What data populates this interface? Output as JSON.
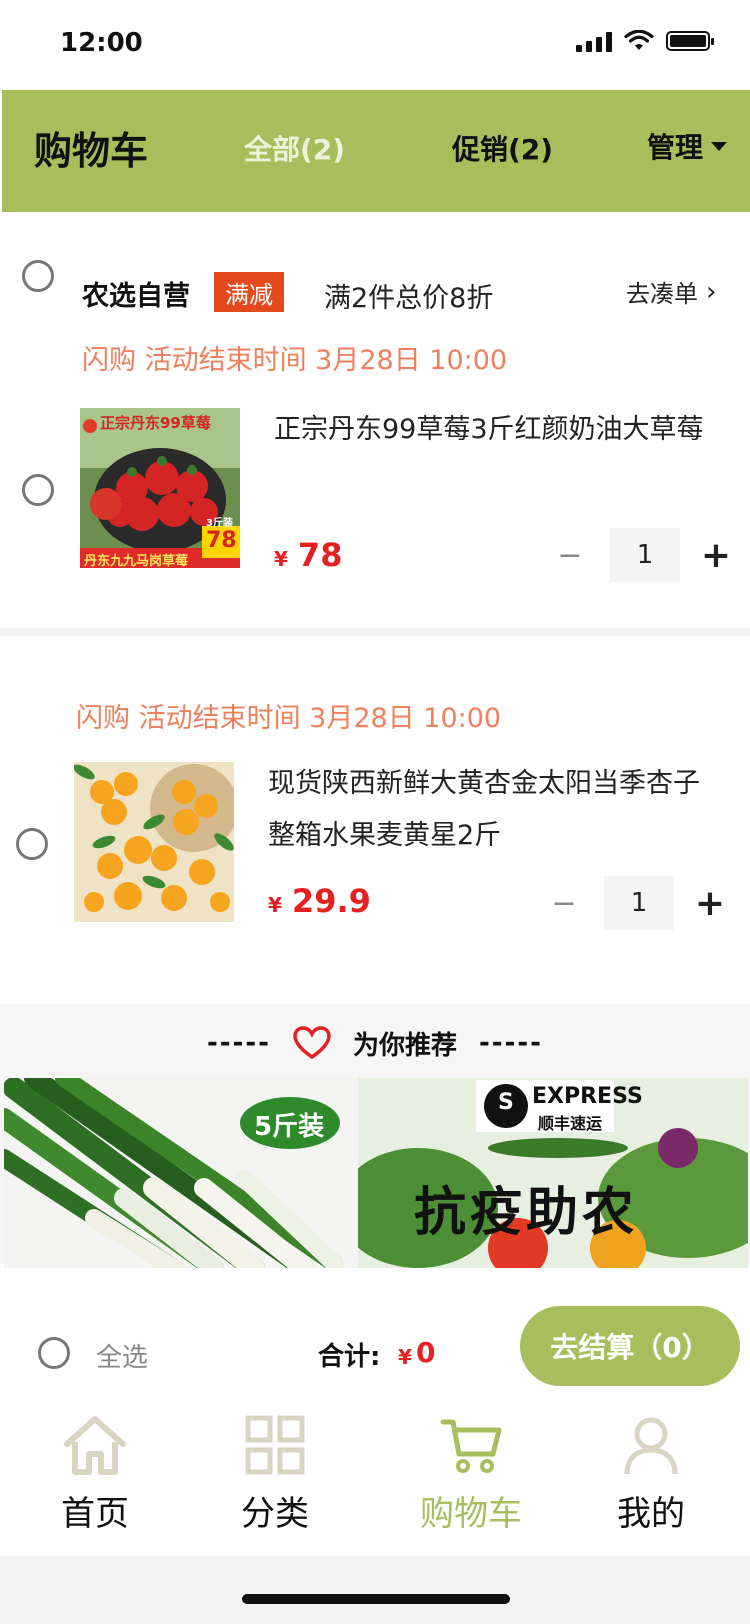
{
  "status": {
    "time": "12:00"
  },
  "header": {
    "title": "购物车",
    "tab_all": "全部(2)",
    "tab_promo": "促销(2)",
    "manage": "管理"
  },
  "store": {
    "name": "农选自营",
    "tag": "满减",
    "promo": "满2件总价8折",
    "go_add": "去凑单",
    "go_add_chevron": "›"
  },
  "items": [
    {
      "flash": "闪购 活动结束时间 3月28日 10:00",
      "title": "正宗丹东99草莓3斤红颜奶油大草莓",
      "currency": "¥",
      "price": "78",
      "qty": "1",
      "image_text": {
        "banner": "正宗丹东99草莓",
        "bottom": "丹东九九马岗草莓",
        "price_badge": "78",
        "pack": "3斤装"
      }
    },
    {
      "flash": "闪购 活动结束时间 3月28日 10:00",
      "title_line1": "现货陕西新鲜大黄杏金太阳当季杏子",
      "title_line2": "整箱水果麦黄星2斤",
      "currency": "¥",
      "price": "29.9",
      "qty": "1"
    }
  ],
  "stepper": {
    "minus": "−",
    "plus": "+"
  },
  "recommend": {
    "dash_left": "-----",
    "title": "为你推荐",
    "dash_right": "-----",
    "cards": [
      {
        "badge": "5斤装"
      },
      {
        "brand": "EXPRESS",
        "brand_sub": "顺丰速运",
        "headline": "抗疫助农"
      }
    ]
  },
  "footer": {
    "select_all": "全选",
    "total_label": "合计:",
    "total_currency": "¥",
    "total_value": "0",
    "checkout": "去结算（0）"
  },
  "tabbar": [
    {
      "label": "首页",
      "icon": "home-icon"
    },
    {
      "label": "分类",
      "icon": "grid-icon"
    },
    {
      "label": "购物车",
      "icon": "cart-icon",
      "active": true
    },
    {
      "label": "我的",
      "icon": "user-icon"
    }
  ],
  "colors": {
    "accent": "#a8bd5c",
    "price": "#e62020",
    "flash": "#f0805d",
    "tag": "#e4481d"
  }
}
